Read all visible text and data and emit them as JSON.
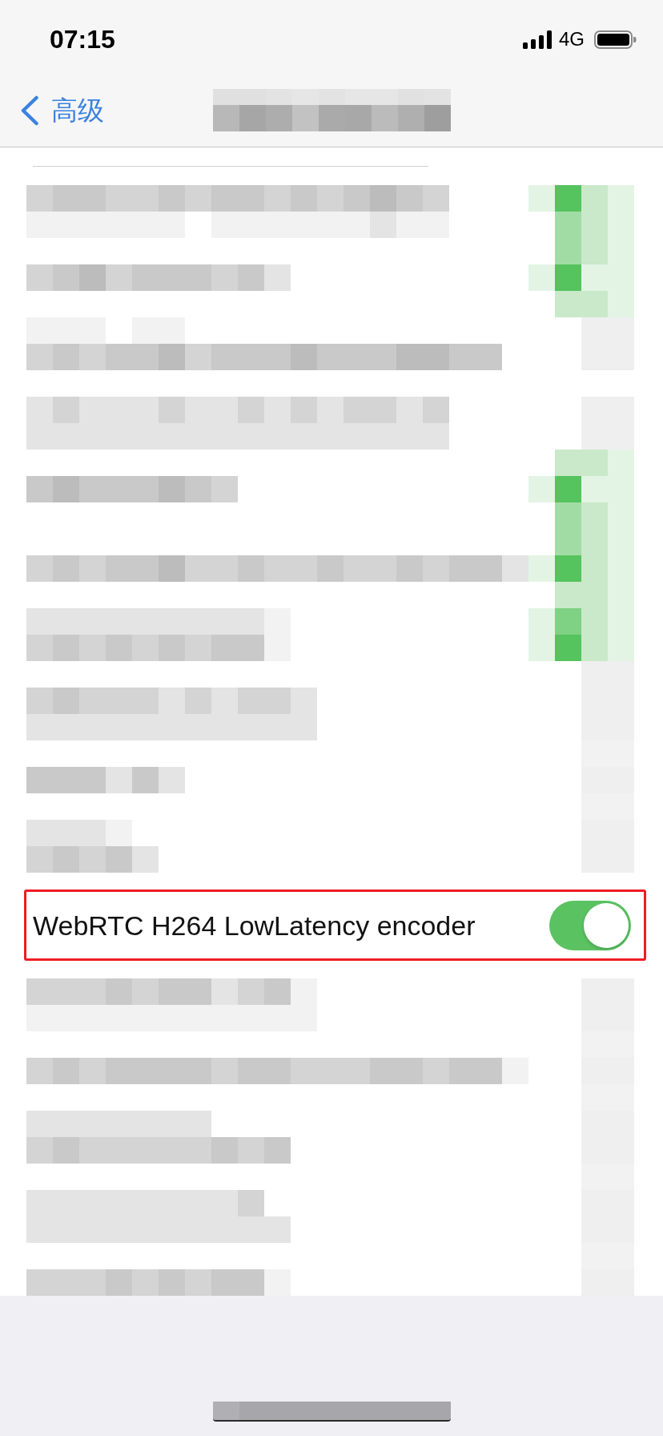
{
  "status_bar": {
    "time": "07:15",
    "network": "4G"
  },
  "nav_bar": {
    "back_label": "高级",
    "title_obscured": true
  },
  "rows": [
    {
      "kind": "pixelated"
    },
    {
      "kind": "switch",
      "label": "WebRTC H264 LowLatency encoder",
      "on": true,
      "highlighted": true
    },
    {
      "kind": "pixelated"
    }
  ]
}
